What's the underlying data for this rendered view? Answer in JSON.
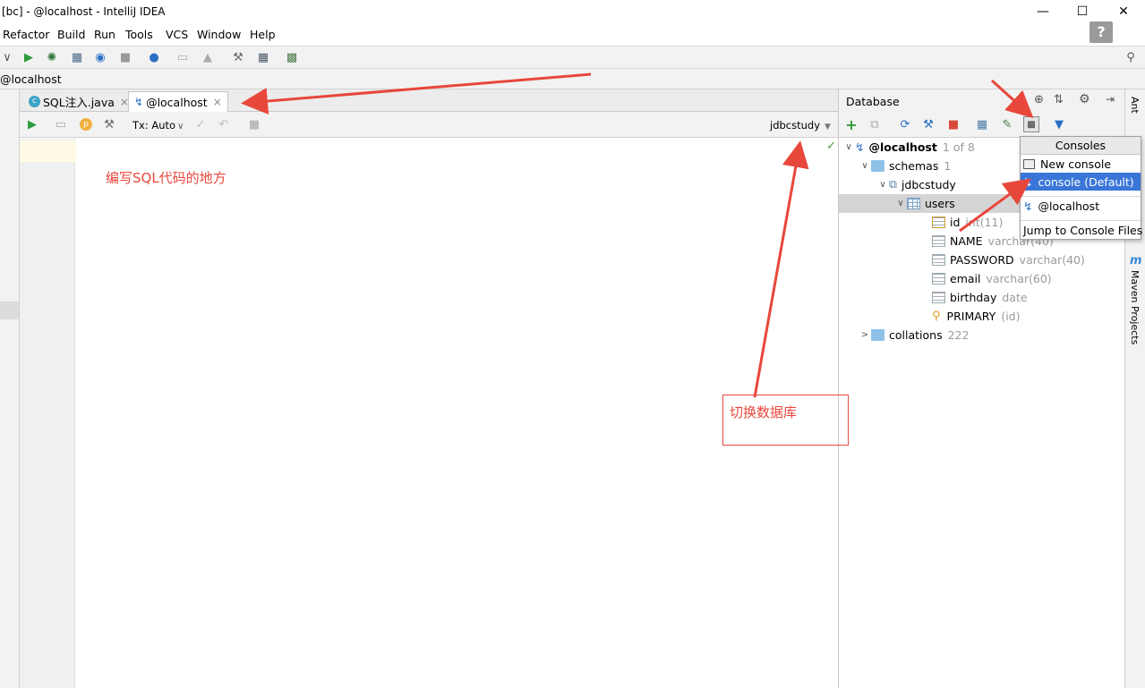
{
  "window": {
    "title": "[bc] - @localhost - IntelliJ IDEA"
  },
  "menu": [
    "Refactor",
    "Build",
    "Run",
    "Tools",
    "VCS",
    "Window",
    "Help"
  ],
  "breadcrumb": "@localhost",
  "tabs": [
    {
      "label": "SQL注入.java",
      "close": "×"
    },
    {
      "label": "@localhost",
      "close": "×"
    }
  ],
  "editor_toolbar": {
    "tx_mode": "Tx: Auto",
    "schema_selector": "jdbcstudy"
  },
  "database_panel": {
    "title": "Database",
    "tree": {
      "root": {
        "label": "@localhost",
        "meta": "1 of 8"
      },
      "schemas": {
        "label": "schemas",
        "meta": "1"
      },
      "schema": {
        "label": "jdbcstudy"
      },
      "table": {
        "label": "users"
      },
      "columns": [
        {
          "name": "id",
          "type": "int(11)",
          "icon": "key-column-icon"
        },
        {
          "name": "NAME",
          "type": "varchar(40)",
          "icon": "column-icon"
        },
        {
          "name": "PASSWORD",
          "type": "varchar(40)",
          "icon": "column-icon"
        },
        {
          "name": "email",
          "type": "varchar(60)",
          "icon": "column-icon"
        },
        {
          "name": "birthday",
          "type": "date",
          "icon": "column-icon"
        },
        {
          "name": "PRIMARY",
          "type": "(id)",
          "icon": "primary-key-icon"
        }
      ],
      "collations": {
        "label": "collations",
        "meta": "222"
      }
    }
  },
  "consoles_popup": {
    "title": "Consoles",
    "new_console": "New console",
    "console_default": "console (Default)",
    "localhost": "@localhost",
    "jump": "Jump to Console Files"
  },
  "right_strip": {
    "ant": "Ant",
    "maven": "Maven Projects"
  },
  "annotations": {
    "editor_note": "编写SQL代码的地方",
    "switch_db": "切换数据库"
  },
  "colors": {
    "annotation": "#e8473c",
    "selection": "#3a75d8"
  }
}
